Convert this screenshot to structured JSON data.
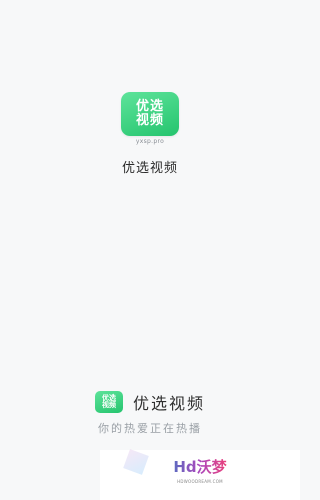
{
  "splash": {
    "logo_line1": "优选",
    "logo_line2": "视频",
    "logo_domain": "yxsp.pro",
    "app_name": "优选视频"
  },
  "footer": {
    "logo_line1": "优选",
    "logo_line2": "视频",
    "brand_name": "优选视频",
    "slogan": "你的热爱正在热播"
  },
  "watermark": {
    "text": "Hd沃梦",
    "domain": "HDWOODREAM.COM"
  },
  "colors": {
    "background": "#f7f8f9",
    "logo_green": "#25c46e"
  }
}
